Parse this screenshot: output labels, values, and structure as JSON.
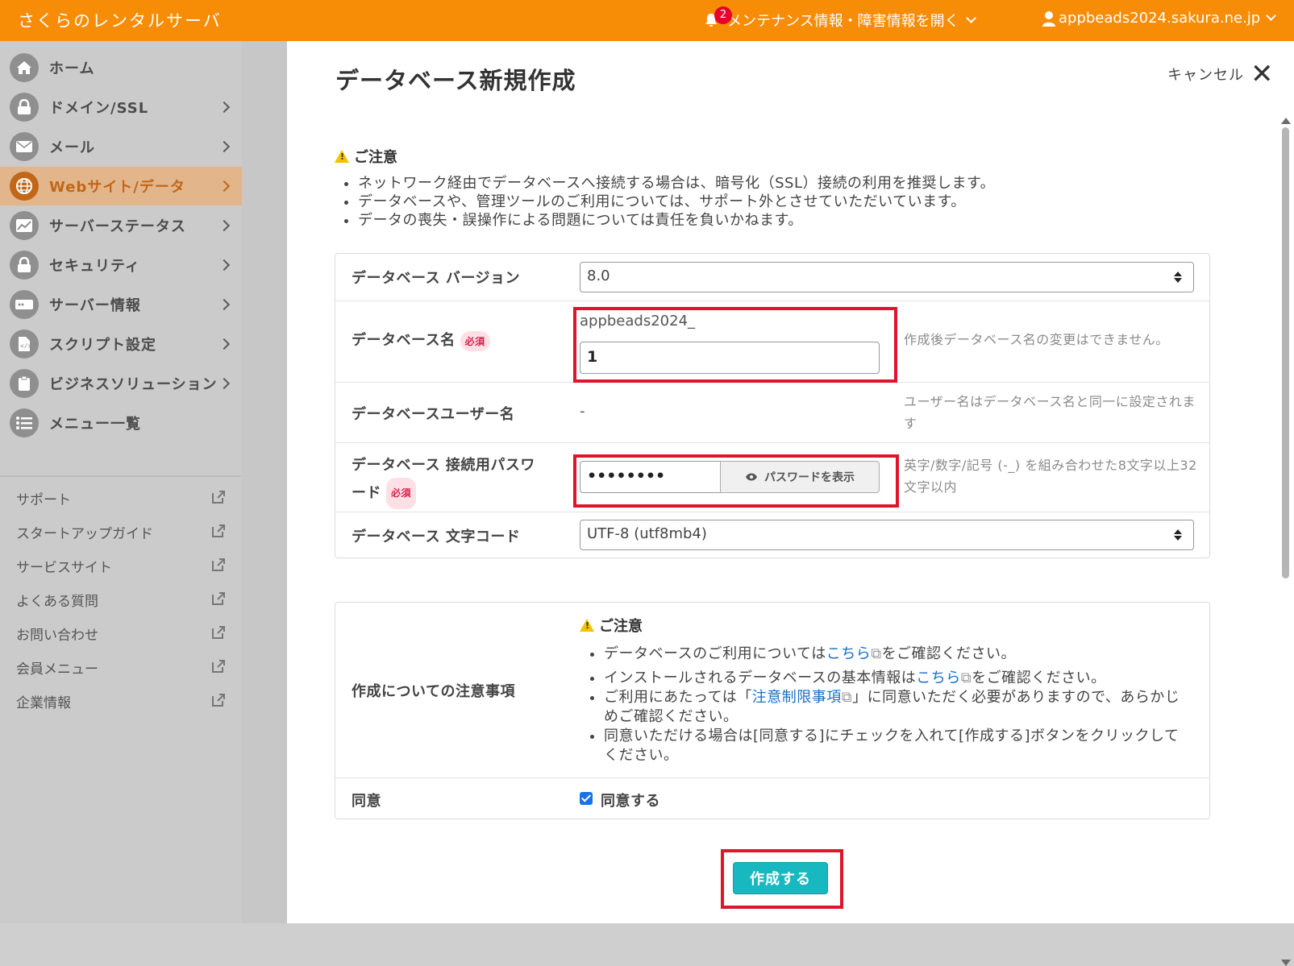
{
  "header": {
    "brand": "さくらのレンタルサーバ",
    "notification_count": "2",
    "notice_label": "メンテナンス情報・障害情報を開く",
    "user_label": "appbeads2024.sakura.ne.jp"
  },
  "sidebar": {
    "items": [
      {
        "label": "ホーム"
      },
      {
        "label": "ドメイン/SSL"
      },
      {
        "label": "メール"
      },
      {
        "label": "Webサイト/データ"
      },
      {
        "label": "サーバーステータス"
      },
      {
        "label": "セキュリティ"
      },
      {
        "label": "サーバー情報"
      },
      {
        "label": "スクリプト設定"
      },
      {
        "label": "ビジネスソリューション"
      },
      {
        "label": "メニュー一覧"
      }
    ],
    "links": [
      {
        "label": "サポート"
      },
      {
        "label": "スタートアップガイド"
      },
      {
        "label": "サービスサイト"
      },
      {
        "label": "よくある質問"
      },
      {
        "label": "お問い合わせ"
      },
      {
        "label": "会員メニュー"
      },
      {
        "label": "企業情報"
      }
    ]
  },
  "modal": {
    "title": "データベース新規作成",
    "cancel_label": "キャンセル",
    "caution_heading": "ご注意",
    "caution_items": [
      "ネットワーク経由でデータベースへ接続する場合は、暗号化（SSL）接続の利用を推奨します。",
      "データベースや、管理ツールのご利用については、サポート外とさせていただいています。",
      "データの喪失・誤操作による問題については責任を負いかねます。"
    ],
    "form": {
      "version_label": "データベース バージョン",
      "version_value": "8.0",
      "dbname_label": "データベース名",
      "required_badge": "必須",
      "dbname_prefix": "appbeads2024_",
      "dbname_value": "1",
      "dbname_hint": "作成後データベース名の変更はできません。",
      "dbuser_label": "データベースユーザー名",
      "dbuser_value": "-",
      "dbuser_hint": "ユーザー名はデータベース名と同一に設定されます",
      "password_label_1": "データベース 接続用パスワ",
      "password_label_2": "ード",
      "password_value": "••••••••",
      "show_password_label": "パスワードを表示",
      "password_hint": "英字/数字/記号 (-_) を組み合わせた8文字以上32文字以内",
      "charset_label": "データベース 文字コード",
      "charset_value": "UTF-8 (utf8mb4)"
    },
    "notes": {
      "row_label": "作成についての注意事項",
      "heading": "ご注意",
      "item1_pre": "データベースのご利用については",
      "item1_link": "こちら",
      "item1_post": "をご確認ください。",
      "item2_pre": "インストールされるデータベースの基本情報は",
      "item2_link": "こちら",
      "item2_post": "をご確認ください。",
      "item3_pre": "ご利用にあたっては「",
      "item3_link": "注意制限事項",
      "item3_post": "」に同意いただく必要がありますので、あらかじめご確認ください。",
      "item4": "同意いただける場合は[同意する]にチェックを入れて[作成する]ボタンをクリックしてください。"
    },
    "agree_label": "同意",
    "agree_checkbox_label": "同意する",
    "create_button": "作成する"
  }
}
